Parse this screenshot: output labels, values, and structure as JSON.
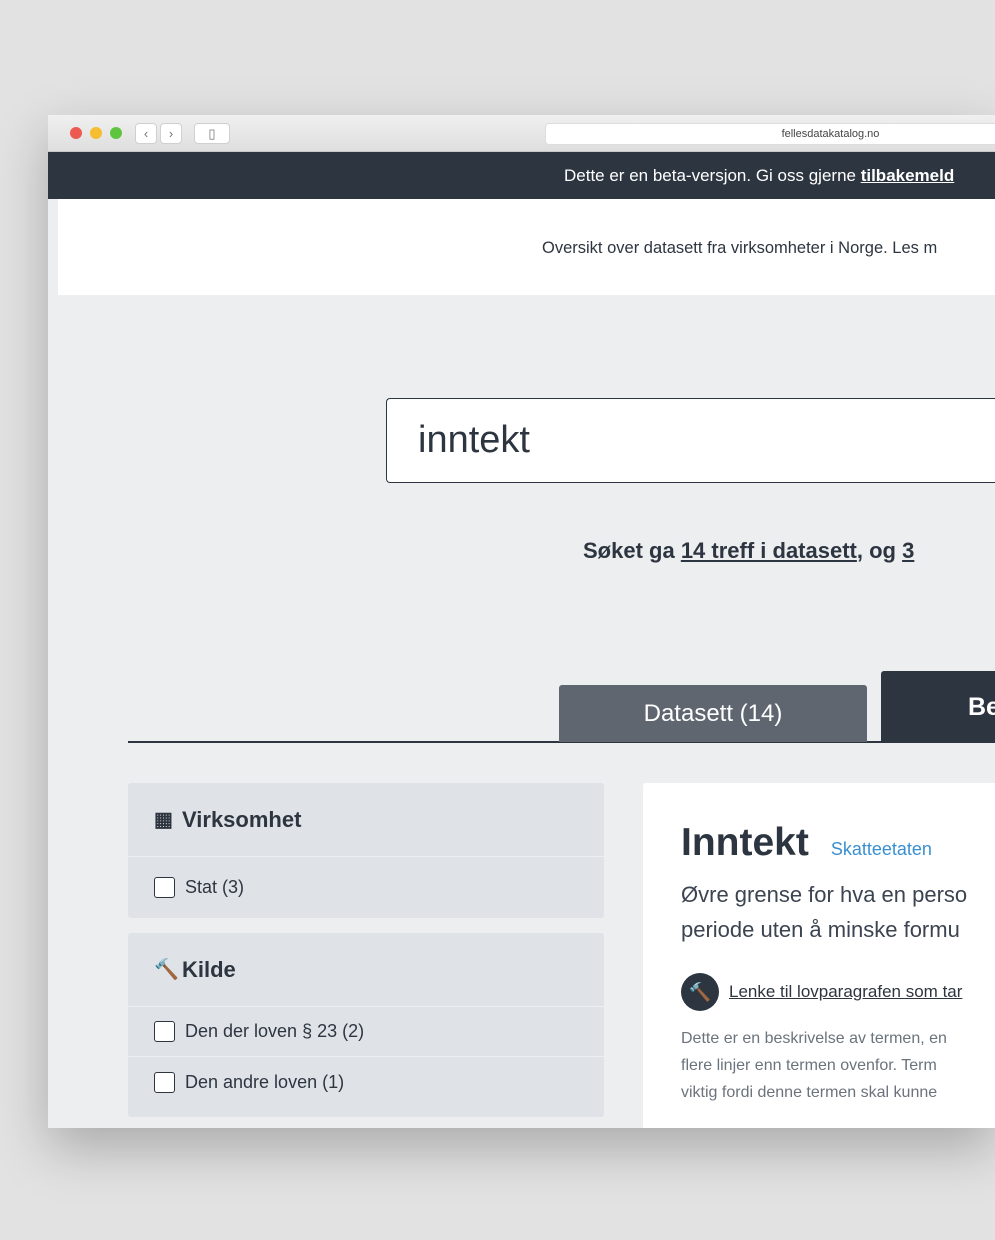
{
  "browser": {
    "url": "fellesdatakatalog.no",
    "colors": {
      "close": "#ed5a52",
      "minimize": "#f5bd2f",
      "maximize": "#5fc53f"
    }
  },
  "banner": {
    "text": "Dette er en beta-versjon. Gi oss gjerne ",
    "link": "tilbakemeld"
  },
  "header": {
    "text": "Oversikt over datasett fra virksomheter i Norge. Les m"
  },
  "search": {
    "value": "inntekt"
  },
  "result": {
    "prefix": "Søket ga ",
    "link1": "14 treff i datasett",
    "middle": ", og ",
    "link2": "3"
  },
  "tabs": [
    {
      "label": "Datasett (14)"
    },
    {
      "label": "Be"
    }
  ],
  "filters": [
    {
      "title": "Virksomhet",
      "icon": "building-icon",
      "options": [
        {
          "label": "Stat (3)",
          "checked": false
        }
      ]
    },
    {
      "title": "Kilde",
      "icon": "gavel-icon",
      "options": [
        {
          "label": "Den der loven § 23 (2)",
          "checked": false
        },
        {
          "label": "Den andre loven (1)",
          "checked": false
        }
      ]
    }
  ],
  "card": {
    "title": "Inntekt",
    "publisher": "Skatteetaten",
    "definition_lines": [
      "Øvre grense for hva en perso",
      "periode uten å minske formu"
    ],
    "law_link": "Lenke til lovparagrafen som tar",
    "description_lines": [
      "Dette er en beskrivelse av termen, en",
      "flere linjer enn termen ovenfor. Term",
      "viktig fordi denne termen skal kunne"
    ]
  },
  "colors": {
    "dark": "#2d3540",
    "tab_inactive": "#5f6670",
    "accent_link": "#3a8fd0"
  }
}
